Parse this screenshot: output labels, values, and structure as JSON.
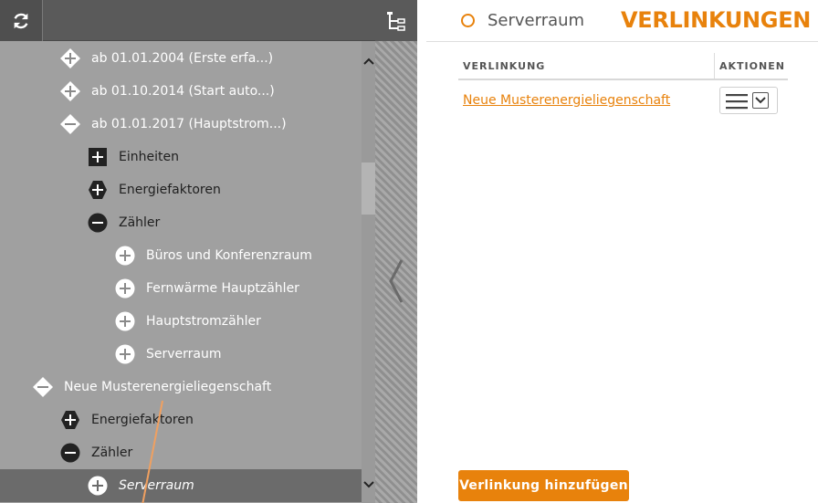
{
  "tree": {
    "rows": [
      {
        "label": "ab 01.01.2004 (Erste erfa...)",
        "icon": "plus-diamond-icon"
      },
      {
        "label": "ab 01.10.2014 (Start auto...)",
        "icon": "plus-diamond-icon"
      },
      {
        "label": "ab 01.01.2017 (Hauptstrom...)",
        "icon": "minus-diamond-icon"
      },
      {
        "label": "Einheiten",
        "icon": "plus-square-icon"
      },
      {
        "label": "Energiefaktoren",
        "icon": "plus-hexagon-icon"
      },
      {
        "label": "Zähler",
        "icon": "minus-circle-icon"
      },
      {
        "label": "Büros und Konferenzraum",
        "icon": "plus-circle-icon"
      },
      {
        "label": "Fernwärme Hauptzähler",
        "icon": "plus-circle-icon"
      },
      {
        "label": "Hauptstromzähler",
        "icon": "plus-circle-icon"
      },
      {
        "label": "Serverraum",
        "icon": "plus-circle-icon"
      },
      {
        "label": "Neue Musterenergieliegenschaft",
        "icon": "minus-diamond-icon"
      },
      {
        "label": "Energiefaktoren",
        "icon": "plus-hexagon-icon"
      },
      {
        "label": "Zähler",
        "icon": "minus-circle-icon"
      },
      {
        "label": "Serverraum",
        "icon": "plus-circle-icon"
      }
    ]
  },
  "header": {
    "object_name": "Serverraum",
    "section_title": "VERLINKUNGEN"
  },
  "table": {
    "columns": [
      "VERLINKUNG",
      "AKTIONEN"
    ],
    "rows": [
      {
        "link": "Neue Musterenergieliegenschaft"
      }
    ]
  },
  "footer": {
    "add_button_label": "Verlinkung hinzufügen"
  },
  "colors": {
    "accent": "#e8820c",
    "panel_bg": "#a0a0a0",
    "toolbar_bg": "#5a5a5a",
    "selected_row_bg": "#6b6b6b"
  }
}
